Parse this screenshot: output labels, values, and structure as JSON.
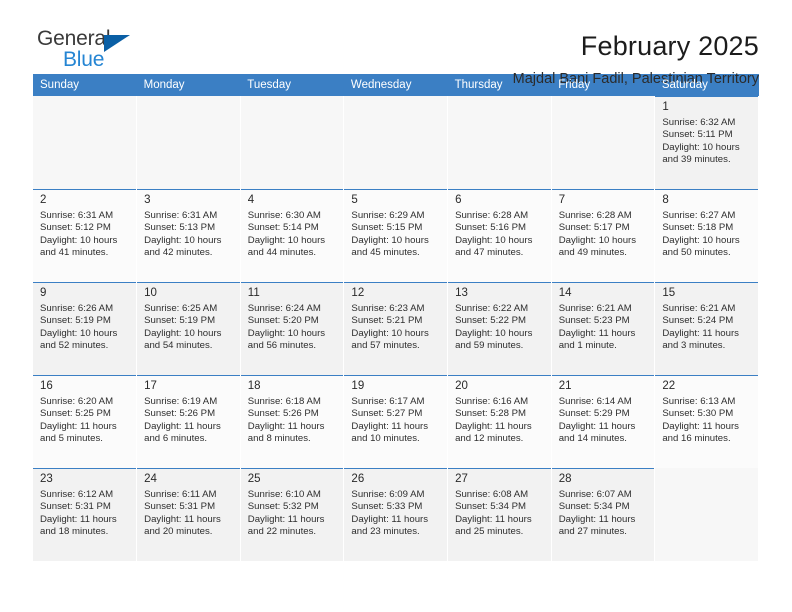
{
  "brand": {
    "name_top": "General",
    "name_bottom": "Blue",
    "accent_color": "#2585d3",
    "triangle_color": "#0a5fa5"
  },
  "header": {
    "title": "February 2025",
    "subtitle": "Majdal Bani Fadil, Palestinian Territory",
    "header_bg": "#3b7fc4"
  },
  "calendar": {
    "weekday_headers": [
      "Sunday",
      "Monday",
      "Tuesday",
      "Wednesday",
      "Thursday",
      "Friday",
      "Saturday"
    ],
    "labels": {
      "sunrise": "Sunrise:",
      "sunset": "Sunset:",
      "daylight": "Daylight:"
    },
    "weeks": [
      [
        {
          "day": ""
        },
        {
          "day": ""
        },
        {
          "day": ""
        },
        {
          "day": ""
        },
        {
          "day": ""
        },
        {
          "day": ""
        },
        {
          "day": "1",
          "sunrise": "Sunrise: 6:32 AM",
          "sunset": "Sunset: 5:11 PM",
          "daylight_l1": "Daylight: 10 hours",
          "daylight_l2": "and 39 minutes."
        }
      ],
      [
        {
          "day": "2",
          "sunrise": "Sunrise: 6:31 AM",
          "sunset": "Sunset: 5:12 PM",
          "daylight_l1": "Daylight: 10 hours",
          "daylight_l2": "and 41 minutes."
        },
        {
          "day": "3",
          "sunrise": "Sunrise: 6:31 AM",
          "sunset": "Sunset: 5:13 PM",
          "daylight_l1": "Daylight: 10 hours",
          "daylight_l2": "and 42 minutes."
        },
        {
          "day": "4",
          "sunrise": "Sunrise: 6:30 AM",
          "sunset": "Sunset: 5:14 PM",
          "daylight_l1": "Daylight: 10 hours",
          "daylight_l2": "and 44 minutes."
        },
        {
          "day": "5",
          "sunrise": "Sunrise: 6:29 AM",
          "sunset": "Sunset: 5:15 PM",
          "daylight_l1": "Daylight: 10 hours",
          "daylight_l2": "and 45 minutes."
        },
        {
          "day": "6",
          "sunrise": "Sunrise: 6:28 AM",
          "sunset": "Sunset: 5:16 PM",
          "daylight_l1": "Daylight: 10 hours",
          "daylight_l2": "and 47 minutes."
        },
        {
          "day": "7",
          "sunrise": "Sunrise: 6:28 AM",
          "sunset": "Sunset: 5:17 PM",
          "daylight_l1": "Daylight: 10 hours",
          "daylight_l2": "and 49 minutes."
        },
        {
          "day": "8",
          "sunrise": "Sunrise: 6:27 AM",
          "sunset": "Sunset: 5:18 PM",
          "daylight_l1": "Daylight: 10 hours",
          "daylight_l2": "and 50 minutes."
        }
      ],
      [
        {
          "day": "9",
          "sunrise": "Sunrise: 6:26 AM",
          "sunset": "Sunset: 5:19 PM",
          "daylight_l1": "Daylight: 10 hours",
          "daylight_l2": "and 52 minutes."
        },
        {
          "day": "10",
          "sunrise": "Sunrise: 6:25 AM",
          "sunset": "Sunset: 5:19 PM",
          "daylight_l1": "Daylight: 10 hours",
          "daylight_l2": "and 54 minutes."
        },
        {
          "day": "11",
          "sunrise": "Sunrise: 6:24 AM",
          "sunset": "Sunset: 5:20 PM",
          "daylight_l1": "Daylight: 10 hours",
          "daylight_l2": "and 56 minutes."
        },
        {
          "day": "12",
          "sunrise": "Sunrise: 6:23 AM",
          "sunset": "Sunset: 5:21 PM",
          "daylight_l1": "Daylight: 10 hours",
          "daylight_l2": "and 57 minutes."
        },
        {
          "day": "13",
          "sunrise": "Sunrise: 6:22 AM",
          "sunset": "Sunset: 5:22 PM",
          "daylight_l1": "Daylight: 10 hours",
          "daylight_l2": "and 59 minutes."
        },
        {
          "day": "14",
          "sunrise": "Sunrise: 6:21 AM",
          "sunset": "Sunset: 5:23 PM",
          "daylight_l1": "Daylight: 11 hours",
          "daylight_l2": "and 1 minute."
        },
        {
          "day": "15",
          "sunrise": "Sunrise: 6:21 AM",
          "sunset": "Sunset: 5:24 PM",
          "daylight_l1": "Daylight: 11 hours",
          "daylight_l2": "and 3 minutes."
        }
      ],
      [
        {
          "day": "16",
          "sunrise": "Sunrise: 6:20 AM",
          "sunset": "Sunset: 5:25 PM",
          "daylight_l1": "Daylight: 11 hours",
          "daylight_l2": "and 5 minutes."
        },
        {
          "day": "17",
          "sunrise": "Sunrise: 6:19 AM",
          "sunset": "Sunset: 5:26 PM",
          "daylight_l1": "Daylight: 11 hours",
          "daylight_l2": "and 6 minutes."
        },
        {
          "day": "18",
          "sunrise": "Sunrise: 6:18 AM",
          "sunset": "Sunset: 5:26 PM",
          "daylight_l1": "Daylight: 11 hours",
          "daylight_l2": "and 8 minutes."
        },
        {
          "day": "19",
          "sunrise": "Sunrise: 6:17 AM",
          "sunset": "Sunset: 5:27 PM",
          "daylight_l1": "Daylight: 11 hours",
          "daylight_l2": "and 10 minutes."
        },
        {
          "day": "20",
          "sunrise": "Sunrise: 6:16 AM",
          "sunset": "Sunset: 5:28 PM",
          "daylight_l1": "Daylight: 11 hours",
          "daylight_l2": "and 12 minutes."
        },
        {
          "day": "21",
          "sunrise": "Sunrise: 6:14 AM",
          "sunset": "Sunset: 5:29 PM",
          "daylight_l1": "Daylight: 11 hours",
          "daylight_l2": "and 14 minutes."
        },
        {
          "day": "22",
          "sunrise": "Sunrise: 6:13 AM",
          "sunset": "Sunset: 5:30 PM",
          "daylight_l1": "Daylight: 11 hours",
          "daylight_l2": "and 16 minutes."
        }
      ],
      [
        {
          "day": "23",
          "sunrise": "Sunrise: 6:12 AM",
          "sunset": "Sunset: 5:31 PM",
          "daylight_l1": "Daylight: 11 hours",
          "daylight_l2": "and 18 minutes."
        },
        {
          "day": "24",
          "sunrise": "Sunrise: 6:11 AM",
          "sunset": "Sunset: 5:31 PM",
          "daylight_l1": "Daylight: 11 hours",
          "daylight_l2": "and 20 minutes."
        },
        {
          "day": "25",
          "sunrise": "Sunrise: 6:10 AM",
          "sunset": "Sunset: 5:32 PM",
          "daylight_l1": "Daylight: 11 hours",
          "daylight_l2": "and 22 minutes."
        },
        {
          "day": "26",
          "sunrise": "Sunrise: 6:09 AM",
          "sunset": "Sunset: 5:33 PM",
          "daylight_l1": "Daylight: 11 hours",
          "daylight_l2": "and 23 minutes."
        },
        {
          "day": "27",
          "sunrise": "Sunrise: 6:08 AM",
          "sunset": "Sunset: 5:34 PM",
          "daylight_l1": "Daylight: 11 hours",
          "daylight_l2": "and 25 minutes."
        },
        {
          "day": "28",
          "sunrise": "Sunrise: 6:07 AM",
          "sunset": "Sunset: 5:34 PM",
          "daylight_l1": "Daylight: 11 hours",
          "daylight_l2": "and 27 minutes."
        },
        {
          "day": ""
        }
      ]
    ]
  }
}
